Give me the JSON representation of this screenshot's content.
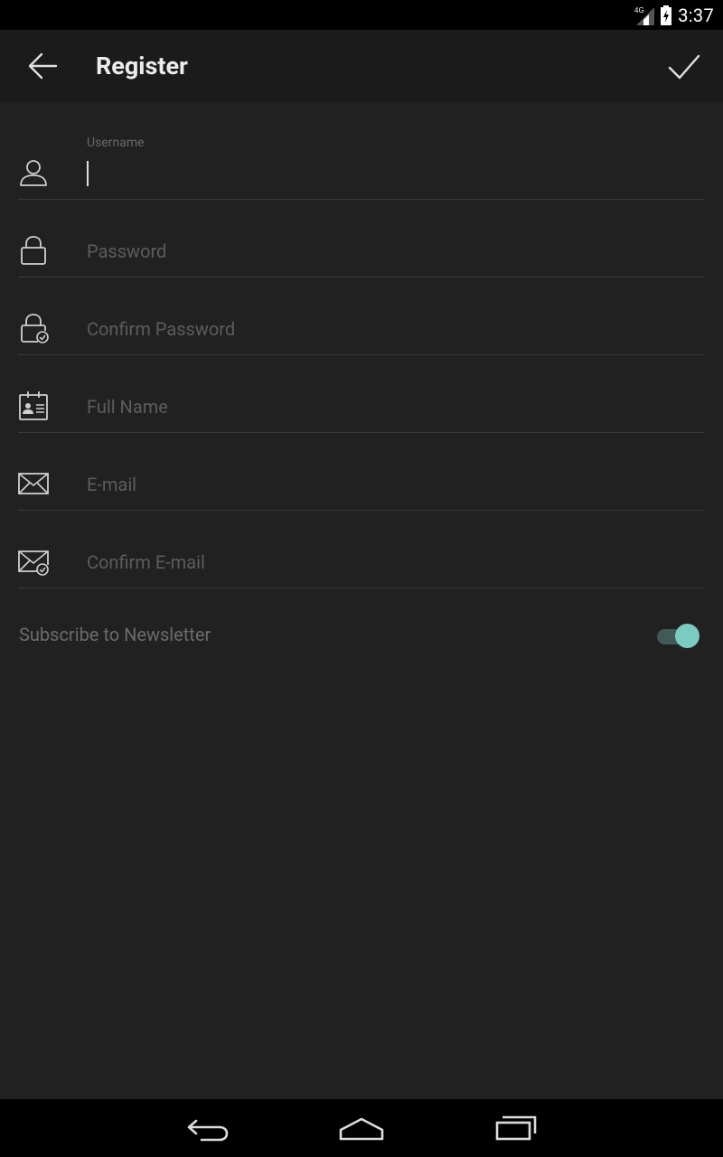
{
  "status_bar": {
    "network": "4G",
    "time": "3:37"
  },
  "toolbar": {
    "title": "Register"
  },
  "form": {
    "username": {
      "label": "Username",
      "value": ""
    },
    "password": {
      "placeholder": "Password"
    },
    "confirm_password": {
      "placeholder": "Confirm Password"
    },
    "full_name": {
      "placeholder": "Full Name"
    },
    "email": {
      "placeholder": "E-mail"
    },
    "confirm_email": {
      "placeholder": "Confirm E-mail"
    }
  },
  "newsletter": {
    "label": "Subscribe to Newsletter",
    "enabled": true
  },
  "colors": {
    "accent": "#7ccbc0",
    "background": "#212121",
    "toolbar": "#1b1b1b"
  },
  "icons": [
    "arrow-back-icon",
    "check-icon",
    "user-icon",
    "lock-icon",
    "lock-check-icon",
    "id-card-icon",
    "mail-icon",
    "mail-check-icon",
    "nav-back-icon",
    "nav-home-icon",
    "nav-recents-icon",
    "signal-icon",
    "battery-icon"
  ]
}
